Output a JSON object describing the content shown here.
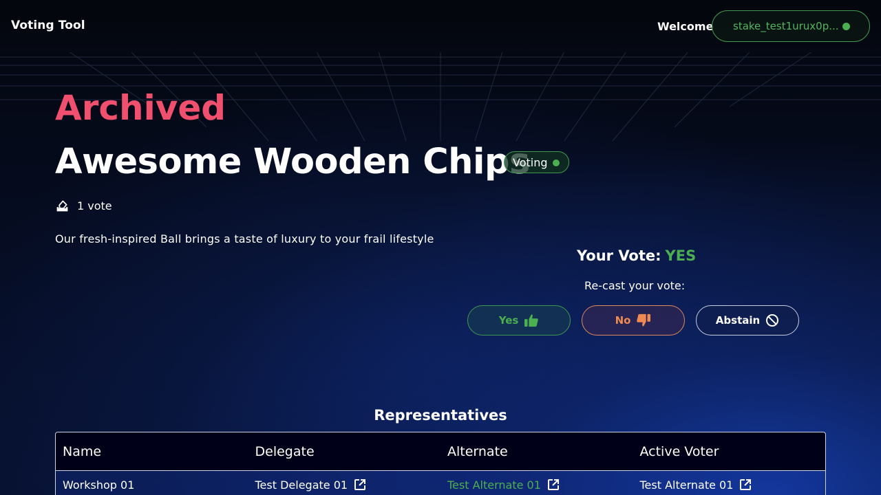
{
  "header": {
    "brand": "Voting Tool",
    "welcome": "Welcome",
    "wallet_address": "stake_test1urux0p..."
  },
  "proposal": {
    "state": "Archived",
    "title": "Awesome Wooden Chips",
    "status": "Voting",
    "vote_count": "1 vote",
    "description": "Our fresh-inspired Ball brings a taste of luxury to your frail lifestyle"
  },
  "vote": {
    "label": "Your Vote:",
    "value": "YES",
    "recast_label": "Re-cast your vote:",
    "options": {
      "yes": "Yes",
      "no": "No",
      "abstain": "Abstain"
    }
  },
  "representatives": {
    "title": "Representatives",
    "columns": [
      "Name",
      "Delegate",
      "Alternate",
      "Active Voter"
    ],
    "rows": [
      [
        "Workshop 01",
        "Test Delegate 01",
        "Test Alternate 01",
        "Test Alternate 01"
      ]
    ]
  },
  "colors": {
    "accent_green": "#4caf50",
    "archived_red": "#f0506e",
    "no_orange": "#ef8a52"
  },
  "icons": {
    "wallet_status": "green-dot-icon",
    "votes": "ballot-box-icon",
    "yes": "thumbs-up-icon",
    "no": "thumbs-down-icon",
    "abstain": "ban-icon",
    "external": "external-link-icon"
  }
}
